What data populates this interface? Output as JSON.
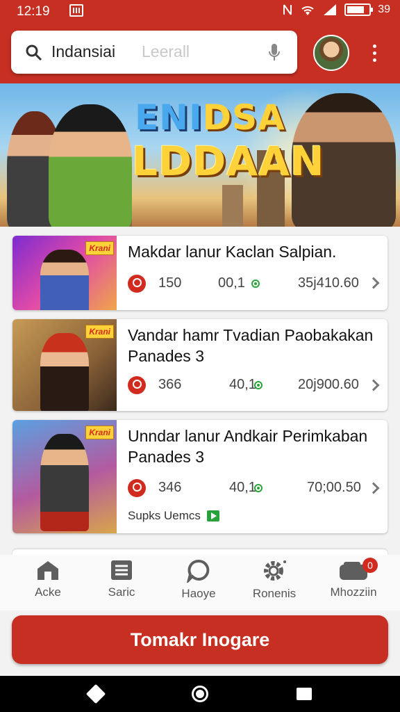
{
  "status_bar": {
    "time": "12:19",
    "battery_text": "39"
  },
  "search": {
    "query": "Indansiai",
    "placeholder": "Leerall"
  },
  "icons": {
    "search": "search-icon",
    "mic": "mic-icon",
    "more": "more-vert-icon",
    "home": "home-icon",
    "list": "list-icon",
    "chat": "chat-icon",
    "settings": "gear-icon",
    "wallet": "wallet-icon"
  },
  "banner": {
    "title_line1_a": "ENI",
    "title_line1_b": "DSA",
    "title_line2": "LDDAAN"
  },
  "items": [
    {
      "badge": "Krani",
      "title": "Makdar lanur Kaclan Salpian.",
      "stat1": "150",
      "stat2": "00,1",
      "stat3": "35j410.60"
    },
    {
      "badge": "Krani",
      "title": "Vandar hamr Tvadian Paobakakan Panades 3",
      "stat1": "366",
      "stat2": "40,1",
      "stat3": "20j900.60"
    },
    {
      "badge": "Krani",
      "title": "Unndar lanur Andkair Perimkaban Panades 3",
      "stat1": "346",
      "stat2": "40,1",
      "stat3": "70;00.50",
      "sub": "Supks Uemcs"
    }
  ],
  "nav": [
    {
      "label": "Acke"
    },
    {
      "label": "Saric"
    },
    {
      "label": "Haoye"
    },
    {
      "label": "Ronenis"
    },
    {
      "label": "Mhozziin",
      "badge": "0"
    }
  ],
  "cta": {
    "label": "Tomakr Inogare"
  },
  "colors": {
    "primary": "#c62f22",
    "accent_green": "#2aa438",
    "title_gold": "#ffd23a"
  }
}
